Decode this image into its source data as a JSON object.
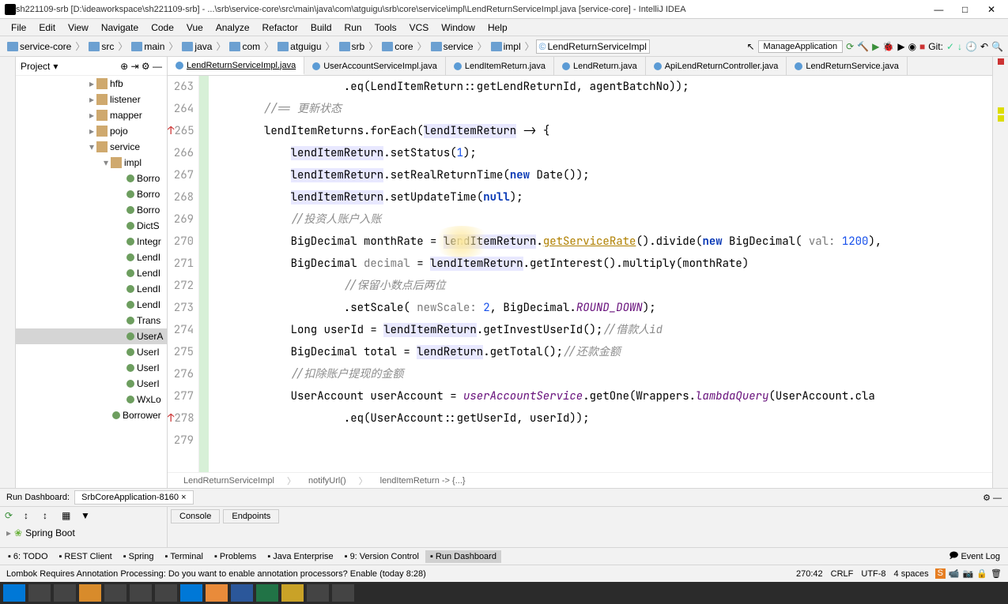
{
  "window": {
    "title": "sh221109-srb [D:\\ideaworkspace\\sh221109-srb] - ...\\srb\\service-core\\src\\main\\java\\com\\atguigu\\srb\\core\\service\\impl\\LendReturnServiceImpl.java [service-core] - IntelliJ IDEA"
  },
  "menu": [
    "File",
    "Edit",
    "View",
    "Navigate",
    "Code",
    "Vue",
    "Analyze",
    "Refactor",
    "Build",
    "Run",
    "Tools",
    "VCS",
    "Window",
    "Help"
  ],
  "breadcrumbs": [
    "service-core",
    "src",
    "main",
    "java",
    "com",
    "atguigu",
    "srb",
    "core",
    "service",
    "impl",
    "LendReturnServiceImpl"
  ],
  "run_config": "ManageApplication",
  "git_label": "Git:",
  "project_label": "Project",
  "tree": [
    {
      "indent": 90,
      "type": "folder",
      "exp": "▸",
      "label": "hfb"
    },
    {
      "indent": 90,
      "type": "folder",
      "exp": "▸",
      "label": "listener"
    },
    {
      "indent": 90,
      "type": "folder",
      "exp": "▸",
      "label": "mapper"
    },
    {
      "indent": 90,
      "type": "folder",
      "exp": "▸",
      "label": "pojo"
    },
    {
      "indent": 90,
      "type": "folder",
      "exp": "▾",
      "label": "service"
    },
    {
      "indent": 108,
      "type": "folder",
      "exp": "▾",
      "label": "impl"
    },
    {
      "indent": 126,
      "type": "class",
      "label": "Borro"
    },
    {
      "indent": 126,
      "type": "class",
      "label": "Borro"
    },
    {
      "indent": 126,
      "type": "class",
      "label": "Borro"
    },
    {
      "indent": 126,
      "type": "class",
      "label": "DictS"
    },
    {
      "indent": 126,
      "type": "class",
      "label": "Integr"
    },
    {
      "indent": 126,
      "type": "class",
      "label": "LendI"
    },
    {
      "indent": 126,
      "type": "class",
      "label": "LendI"
    },
    {
      "indent": 126,
      "type": "class",
      "label": "LendI"
    },
    {
      "indent": 126,
      "type": "class",
      "label": "LendI"
    },
    {
      "indent": 126,
      "type": "class",
      "label": "Trans"
    },
    {
      "indent": 126,
      "type": "class",
      "label": "UserA",
      "sel": true
    },
    {
      "indent": 126,
      "type": "class",
      "label": "UserI"
    },
    {
      "indent": 126,
      "type": "class",
      "label": "UserI"
    },
    {
      "indent": 126,
      "type": "class",
      "label": "UserI"
    },
    {
      "indent": 126,
      "type": "class",
      "label": "WxLo"
    },
    {
      "indent": 108,
      "type": "class",
      "label": "Borrower"
    }
  ],
  "tabs": [
    {
      "label": "LendReturnServiceImpl.java",
      "active": true
    },
    {
      "label": "UserAccountServiceImpl.java"
    },
    {
      "label": "LendItemReturn.java"
    },
    {
      "label": "LendReturn.java"
    },
    {
      "label": "ApiLendReturnController.java"
    },
    {
      "label": "LendReturnService.java"
    }
  ],
  "lines": [
    {
      "n": 263,
      "tokens": [
        {
          "t": "            .eq(LendItemReturn::getLendReturnId, agentBatchNo));",
          "c": ""
        }
      ]
    },
    {
      "n": 264,
      "tokens": [
        {
          "t": "//== 更新状态",
          "c": "cm"
        }
      ]
    },
    {
      "n": 265,
      "mark": "↑",
      "tokens": [
        {
          "t": "lendItemReturns",
          "c": ""
        },
        {
          "t": ".forEach(",
          "c": ""
        },
        {
          "t": "lendItemReturn",
          "c": "ref"
        },
        {
          "t": " -> {",
          "c": ""
        }
      ]
    },
    {
      "n": 266,
      "tokens": [
        {
          "t": "    ",
          "c": ""
        },
        {
          "t": "lendItemReturn",
          "c": "ref"
        },
        {
          "t": ".setStatus(",
          "c": ""
        },
        {
          "t": "1",
          "c": "num"
        },
        {
          "t": ");",
          "c": ""
        }
      ]
    },
    {
      "n": 267,
      "tokens": [
        {
          "t": "    ",
          "c": ""
        },
        {
          "t": "lendItemReturn",
          "c": "ref"
        },
        {
          "t": ".setRealReturnTime(",
          "c": ""
        },
        {
          "t": "new ",
          "c": "kw"
        },
        {
          "t": "Date());",
          "c": ""
        }
      ]
    },
    {
      "n": 268,
      "tokens": [
        {
          "t": "    ",
          "c": ""
        },
        {
          "t": "lendItemReturn",
          "c": "ref"
        },
        {
          "t": ".setUpdateTime(",
          "c": ""
        },
        {
          "t": "null",
          "c": "kw"
        },
        {
          "t": ");",
          "c": ""
        }
      ]
    },
    {
      "n": 269,
      "tokens": [
        {
          "t": "    ",
          "c": ""
        },
        {
          "t": "//投资人账户入账",
          "c": "cm"
        }
      ]
    },
    {
      "n": 270,
      "hl": true,
      "cursor": true,
      "tokens": [
        {
          "t": "    BigDecimal monthRate = ",
          "c": ""
        },
        {
          "t": "lendItemReturn",
          "c": "ref"
        },
        {
          "t": ".",
          "c": ""
        },
        {
          "t": "getServiceRate",
          "c": "warn"
        },
        {
          "t": "().divide(",
          "c": ""
        },
        {
          "t": "new ",
          "c": "kw"
        },
        {
          "t": "BigDecimal(",
          "c": ""
        },
        {
          "t": " val: ",
          "c": "param"
        },
        {
          "t": "1200",
          "c": "num"
        },
        {
          "t": "),",
          "c": ""
        }
      ]
    },
    {
      "n": 271,
      "tokens": [
        {
          "t": "    BigDecimal ",
          "c": ""
        },
        {
          "t": "decimal",
          "c": "param"
        },
        {
          "t": " = ",
          "c": ""
        },
        {
          "t": "lendItemReturn",
          "c": "ref"
        },
        {
          "t": ".getInterest().multiply(monthRate)",
          "c": ""
        }
      ]
    },
    {
      "n": 272,
      "tokens": [
        {
          "t": "            ",
          "c": ""
        },
        {
          "t": "//保留小数点后两位",
          "c": "cm"
        }
      ]
    },
    {
      "n": 273,
      "tokens": [
        {
          "t": "            .setScale(",
          "c": ""
        },
        {
          "t": " newScale: ",
          "c": "param"
        },
        {
          "t": "2",
          "c": "num"
        },
        {
          "t": ", BigDecimal.",
          "c": ""
        },
        {
          "t": "ROUND_DOWN",
          "c": "id"
        },
        {
          "t": ");",
          "c": ""
        }
      ]
    },
    {
      "n": 274,
      "tokens": [
        {
          "t": "    Long userId = ",
          "c": ""
        },
        {
          "t": "lendItemReturn",
          "c": "ref"
        },
        {
          "t": ".getInvestUserId();",
          "c": ""
        },
        {
          "t": "//借款人id",
          "c": "cm"
        }
      ]
    },
    {
      "n": 275,
      "tokens": [
        {
          "t": "    BigDecimal total = ",
          "c": ""
        },
        {
          "t": "lendReturn",
          "c": "ref"
        },
        {
          "t": ".getTotal();",
          "c": ""
        },
        {
          "t": "//还款金额",
          "c": "cm"
        }
      ]
    },
    {
      "n": 276,
      "tokens": [
        {
          "t": "    ",
          "c": ""
        },
        {
          "t": "//扣除账户提现的金额",
          "c": "cm"
        }
      ]
    },
    {
      "n": 277,
      "tokens": [
        {
          "t": "    UserAccount userAccount = ",
          "c": ""
        },
        {
          "t": "userAccountService",
          "c": "id"
        },
        {
          "t": ".getOne(Wrappers.",
          "c": ""
        },
        {
          "t": "lambdaQuery",
          "c": "id"
        },
        {
          "t": "(UserAccount.cla",
          "c": ""
        }
      ]
    },
    {
      "n": 278,
      "mark": "↑",
      "tokens": [
        {
          "t": "            .eq(UserAccount::getUserId, userId));",
          "c": ""
        }
      ]
    },
    {
      "n": 279,
      "tokens": [
        {
          "t": "",
          "c": ""
        }
      ]
    }
  ],
  "bc2": [
    "LendReturnServiceImpl",
    "notifyUrl()",
    "lendItemReturn -> {...}"
  ],
  "rundash_title": "Run Dashboard:",
  "rundash_tab": "SrbCoreApplication-8160",
  "dash_tabs": [
    "Console",
    "Endpoints"
  ],
  "dash_run_item": "Spring Boot",
  "toolwins": [
    {
      "label": "6: TODO"
    },
    {
      "label": "REST Client"
    },
    {
      "label": "Spring"
    },
    {
      "label": "Terminal"
    },
    {
      "label": "Problems"
    },
    {
      "label": "Java Enterprise"
    },
    {
      "label": "9: Version Control"
    },
    {
      "label": "Run Dashboard",
      "sel": true
    }
  ],
  "event_log": "Event Log",
  "status_message": "Lombok Requires Annotation Processing: Do you want to enable annotation processors? Enable (today 8:28)",
  "status_right": [
    "270:42",
    "CRLF",
    "UTF-8",
    "4 spaces"
  ]
}
